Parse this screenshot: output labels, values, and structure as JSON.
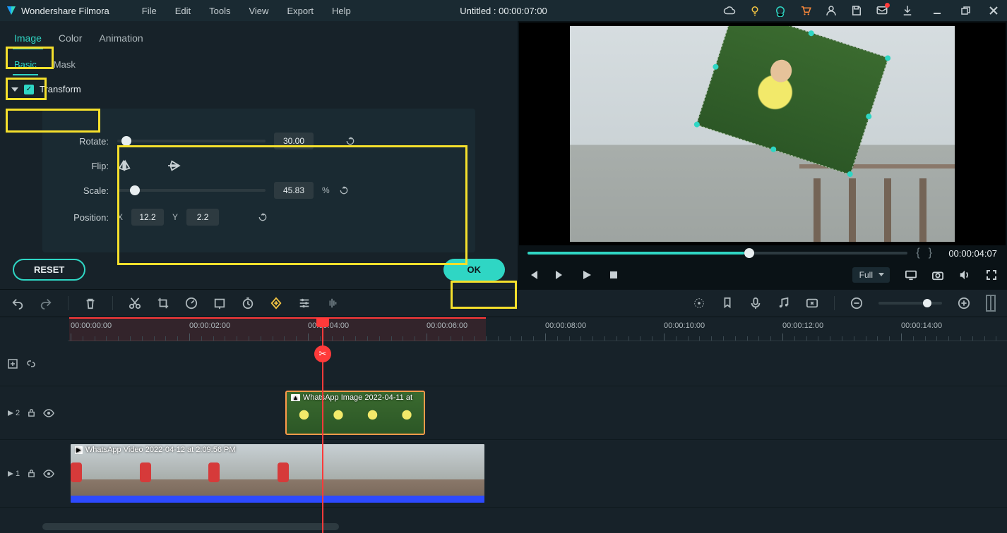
{
  "brand": "Wondershare Filmora",
  "menu": {
    "file": "File",
    "edit": "Edit",
    "tools": "Tools",
    "view": "View",
    "export": "Export",
    "help": "Help"
  },
  "title": "Untitled : 00:00:07:00",
  "tabs": {
    "image": "Image",
    "color": "Color",
    "animation": "Animation"
  },
  "subtabs": {
    "basic": "Basic",
    "mask": "Mask"
  },
  "section": {
    "transform": "Transform"
  },
  "props": {
    "rotate_label": "Rotate:",
    "rotate_val": "30.00",
    "flip_label": "Flip:",
    "scale_label": "Scale:",
    "scale_val": "45.83",
    "scale_unit": "%",
    "pos_label": "Position:",
    "pos_x_label": "X",
    "pos_x": "12.2",
    "pos_y_label": "Y",
    "pos_y": "2.2"
  },
  "actions": {
    "reset": "RESET",
    "ok": "OK"
  },
  "preview": {
    "timecode": "00:00:04:07",
    "quality": "Full"
  },
  "timeline": {
    "ticks": [
      "00:00:00:00",
      "00:00:02:00",
      "00:00:04:00",
      "00:00:06:00",
      "00:00:08:00",
      "00:00:10:00",
      "00:00:12:00",
      "00:00:14:00"
    ],
    "track2": "2",
    "track1": "1",
    "clip_img": "WhatsApp Image 2022-04-11 at",
    "clip_vid": "WhatsApp Video 2022-04-12 at 2:09:56 PM"
  }
}
